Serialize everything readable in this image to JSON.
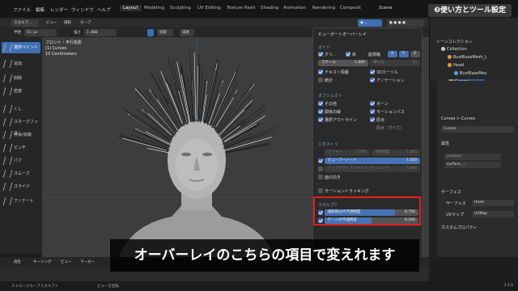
{
  "topbar": {
    "menus": [
      "ファイル",
      "編集",
      "レンダー",
      "ウィンドウ",
      "ヘルプ"
    ],
    "workspaces": [
      "Layout",
      "Modeling",
      "Sculpting",
      "UV Editing",
      "Texture Paint",
      "Shading",
      "Animation",
      "Rendering",
      "Composit"
    ],
    "scene": "Scene",
    "badge": "❷使い方とツール設定"
  },
  "header1": {
    "mode": "スカルプ…",
    "items": [
      "ビュー",
      "選択",
      "カーブ"
    ]
  },
  "header2": {
    "radius_label": "半径",
    "radius_value": "51 px",
    "strength_label": "強さ",
    "strength_value": "1.000",
    "brush": "投影",
    "falloff": "減衰"
  },
  "header3": {
    "radius_label": "強さ",
    "add": "投影",
    "falloff": "減衰"
  },
  "tools": [
    "選択ペイント",
    "追加",
    "削除",
    "密度",
    "くし",
    "スネークフック",
    "伸長/収縮",
    "ピンチ",
    "パフ",
    "スムーズ",
    "スライド",
    "アノテート"
  ],
  "viewport": {
    "line1": "フロント・平行投影",
    "line2": "(1) Curves",
    "line3": "10 Centimeters"
  },
  "overlay": {
    "title": "ビューポートオーバーレイ",
    "guides": {
      "heading": "ガイド",
      "grid": "グリ…",
      "floor": "床",
      "axes": "座標軸",
      "x": "X",
      "y": "Y",
      "z": "Z",
      "scale_label": "スケール",
      "scale_value": "1.000",
      "subdiv_label": "細分化",
      "subdiv_value": "10",
      "text_info": "テキスト情報",
      "cursor_3d": "3Dカーソル",
      "stats": "統計",
      "annotation": "アノテーション"
    },
    "objects": {
      "heading": "オブジェクト",
      "extras": "その他",
      "bones": "ボーン",
      "relations": "関係の線",
      "motion_paths": "モーションパス",
      "outline": "選択アウトライン",
      "origins": "原点",
      "origins_all": "原点（すべて）"
    },
    "geometry": {
      "heading": "ジオメトリ",
      "wireframe_label": "ワイヤー",
      "wireframe_value": "1.000",
      "opacity_label": "不透明度",
      "opacity_value": "1.000",
      "viewer_node": "ビューアーノード",
      "viewer_value": "1.000",
      "fade_label": "インアクティブジオメトリをフェード",
      "fade_value": "0.400",
      "face_orientation": "面の向き",
      "motion_tracking": "モーショントラッキング"
    },
    "sculpt": {
      "heading": "スカルプト",
      "selection_label": "選択部分の不透明度",
      "selection_value": "0.750",
      "selection_level": 0.75,
      "cage_label": "ケージの不透明度",
      "cage_value": "0.500",
      "cage_level": 0.5
    }
  },
  "outliner": {
    "title": "シーンコレクション",
    "items": [
      "Collection",
      "BustBaseMesh_L",
      "Head",
      "BustBaseMes",
      "Curves"
    ]
  },
  "properties": {
    "breadcrumb": "Curves  >  Curves",
    "datablock": "Curves",
    "attributes_heading": "属性",
    "attributes": [
      "position",
      "surface_…"
    ],
    "surface_heading": "サーフェス",
    "surface_label": "サーフェス",
    "surface_value": "Head",
    "uvmap_label": "UVマップ",
    "uvmap_value": "UVMap",
    "custom_props": "カスタムプロパティ"
  },
  "timeline": {
    "playback": "再生",
    "keying": "キーイング",
    "view": "ビュー",
    "marker": "マーカー"
  },
  "statusbar": {
    "left": "ストロークカーブスカルプト",
    "middle": "ビューを回転",
    "version": "3.5.0"
  },
  "caption": "オーバーレイのこちらの項目で変えれます"
}
